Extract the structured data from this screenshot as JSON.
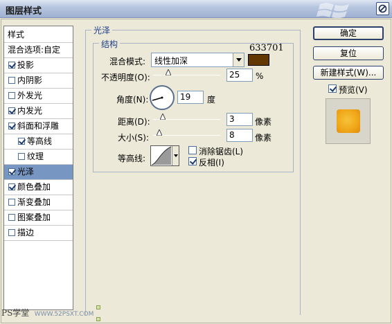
{
  "window": {
    "title": "图层样式"
  },
  "style_list": {
    "header": "样式",
    "blend_options": "混合选项:自定",
    "items": [
      {
        "label": "投影",
        "checked": true,
        "indent": false,
        "selected": false
      },
      {
        "label": "内阴影",
        "checked": false,
        "indent": false,
        "selected": false
      },
      {
        "label": "外发光",
        "checked": false,
        "indent": false,
        "selected": false
      },
      {
        "label": "内发光",
        "checked": true,
        "indent": false,
        "selected": false
      },
      {
        "label": "斜面和浮雕",
        "checked": true,
        "indent": false,
        "selected": false
      },
      {
        "label": "等高线",
        "checked": true,
        "indent": true,
        "selected": false
      },
      {
        "label": "纹理",
        "checked": false,
        "indent": true,
        "selected": false
      },
      {
        "label": "光泽",
        "checked": true,
        "indent": false,
        "selected": true
      },
      {
        "label": "颜色叠加",
        "checked": true,
        "indent": false,
        "selected": false
      },
      {
        "label": "渐变叠加",
        "checked": false,
        "indent": false,
        "selected": false
      },
      {
        "label": "图案叠加",
        "checked": false,
        "indent": false,
        "selected": false
      },
      {
        "label": "描边",
        "checked": false,
        "indent": false,
        "selected": false
      }
    ]
  },
  "satin": {
    "section_title": "光泽",
    "group_title": "结构",
    "blend_mode_label": "混合模式:",
    "blend_mode_value": "线性加深",
    "color_hex_label": "633701",
    "color": "#633701",
    "opacity_label": "不透明度(O):",
    "opacity_value": "25",
    "opacity_unit": "%",
    "angle_label": "角度(N):",
    "angle_value": "19",
    "angle_unit": "度",
    "distance_label": "距离(D):",
    "distance_value": "3",
    "distance_unit": "像素",
    "size_label": "大小(S):",
    "size_value": "8",
    "size_unit": "像素",
    "contour_label": "等高线:",
    "anti_alias_label": "消除锯齿(L)",
    "anti_alias_checked": false,
    "invert_label": "反相(I)",
    "invert_checked": true
  },
  "buttons": {
    "ok": "确定",
    "reset": "复位",
    "new_style": "新建样式(W)...",
    "preview_label": "预览(V)",
    "preview_checked": true
  },
  "watermark": {
    "left": "PS学堂",
    "url": "WWW.52PSXT.COM"
  }
}
